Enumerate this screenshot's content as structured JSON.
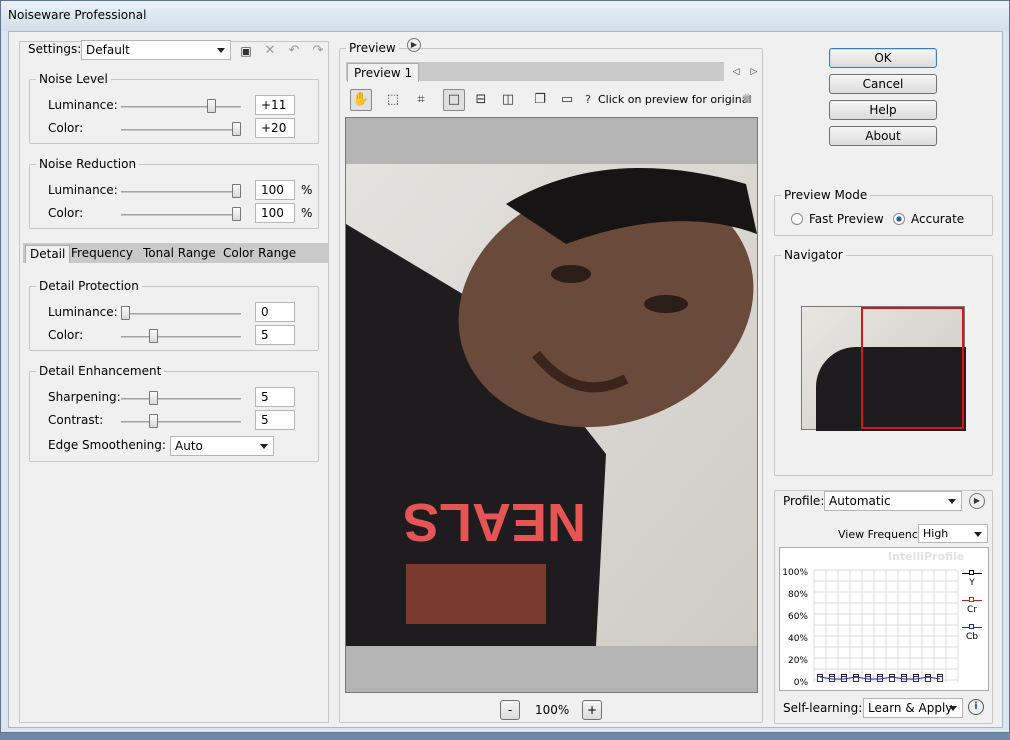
{
  "window": {
    "title": "Noiseware Professional"
  },
  "settings": {
    "label": "Settings:",
    "value": "Default"
  },
  "noise_level": {
    "title": "Noise Level",
    "luminance_label": "Luminance:",
    "luminance_value": "+11",
    "color_label": "Color:",
    "color_value": "+20"
  },
  "noise_reduction": {
    "title": "Noise Reduction",
    "luminance_label": "Luminance:",
    "luminance_value": "100",
    "color_label": "Color:",
    "color_value": "100",
    "unit": "%"
  },
  "tabs": [
    "Detail",
    "Frequency",
    "Tonal Range",
    "Color Range"
  ],
  "detail_protection": {
    "title": "Detail Protection",
    "luminance_label": "Luminance:",
    "luminance_value": "0",
    "color_label": "Color:",
    "color_value": "5"
  },
  "detail_enhancement": {
    "title": "Detail Enhancement",
    "sharpening_label": "Sharpening:",
    "sharpening_value": "5",
    "contrast_label": "Contrast:",
    "contrast_value": "5",
    "edge_label": "Edge Smoothening:",
    "edge_value": "Auto"
  },
  "preview": {
    "title": "Preview",
    "tab_label": "Preview 1",
    "hint": "Click on preview for original",
    "zoom": "100%",
    "zoom_minus": "-",
    "zoom_plus": "+"
  },
  "buttons": {
    "ok": "OK",
    "cancel": "Cancel",
    "help": "Help",
    "about": "About"
  },
  "preview_mode": {
    "title": "Preview Mode",
    "fast": "Fast Preview",
    "accurate": "Accurate",
    "selected": "accurate"
  },
  "navigator": {
    "title": "Navigator"
  },
  "profile": {
    "label": "Profile:",
    "value": "Automatic",
    "view_freq_label": "View Frequency:",
    "view_freq_value": "High",
    "graph_title": "IntelliProfile",
    "y_ticks": [
      "100%",
      "80%",
      "60%",
      "40%",
      "20%",
      "0%"
    ],
    "legend": [
      "Y",
      "Cr",
      "Cb"
    ]
  },
  "self_learning": {
    "label": "Self-learning:",
    "value": "Learn & Apply"
  }
}
